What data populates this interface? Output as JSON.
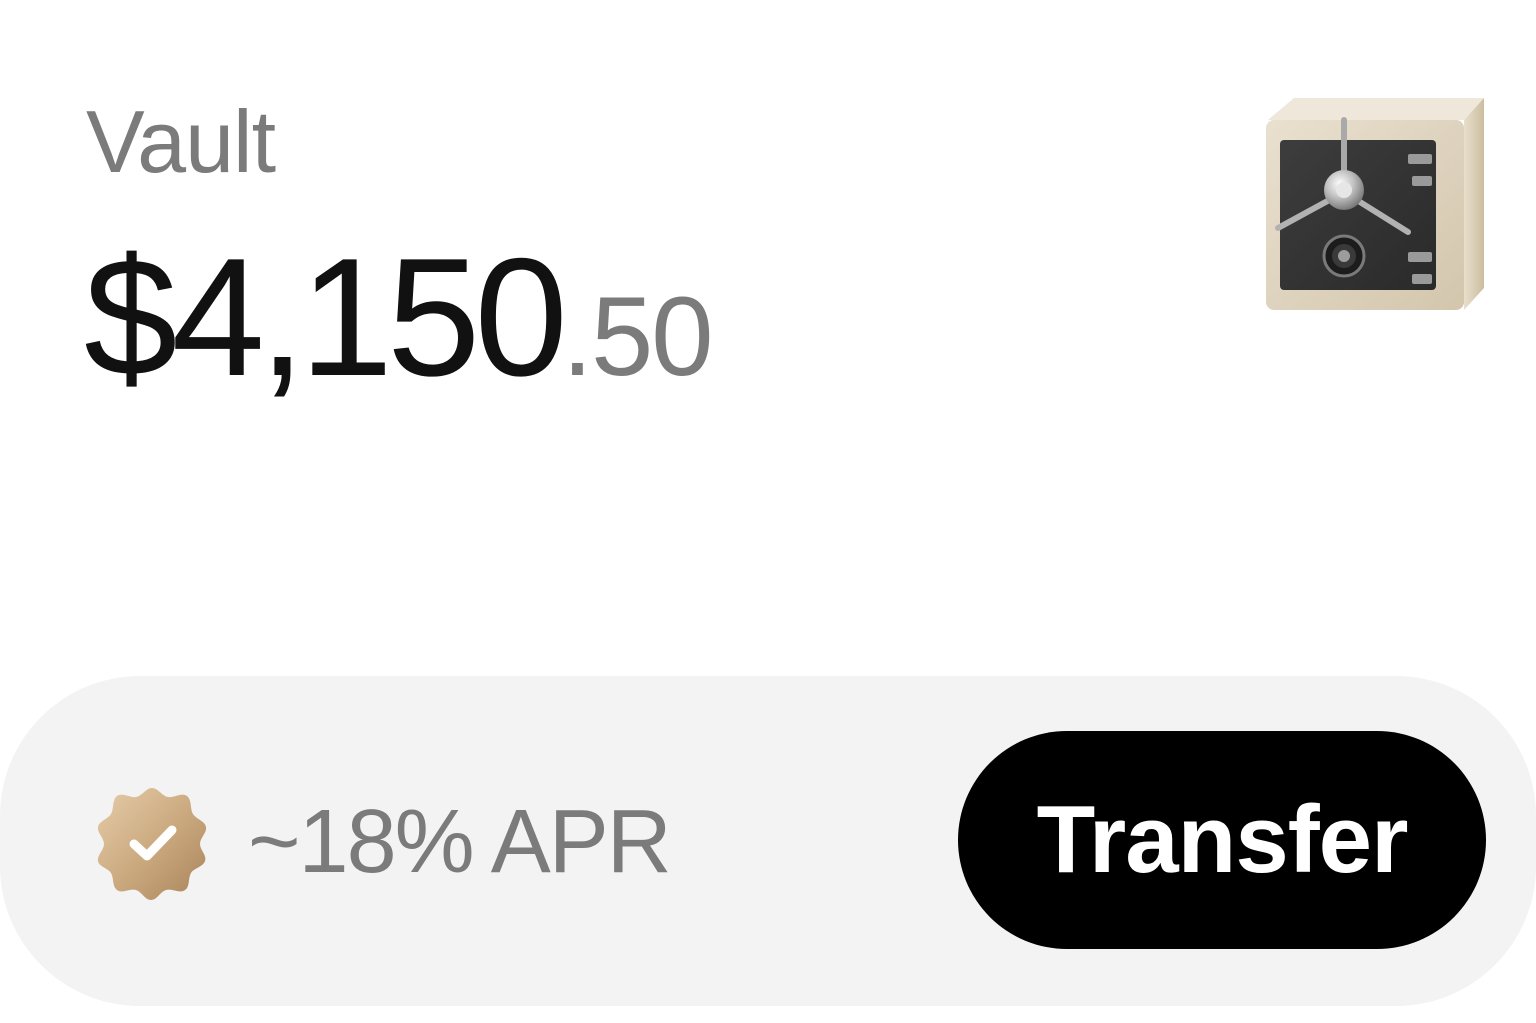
{
  "vault": {
    "title": "Vault",
    "balance_main": "$4,150",
    "balance_cents": ".50",
    "icon": "safe-icon"
  },
  "footer": {
    "badge_icon": "verified-badge-icon",
    "apr_text": "~18% APR",
    "transfer_label": "Transfer"
  },
  "colors": {
    "primary_text": "#111111",
    "secondary_text": "#7b7b7b",
    "footer_bg": "#f3f3f3",
    "button_bg": "#000000",
    "button_text": "#ffffff",
    "badge_gold": "#c9a77c"
  }
}
